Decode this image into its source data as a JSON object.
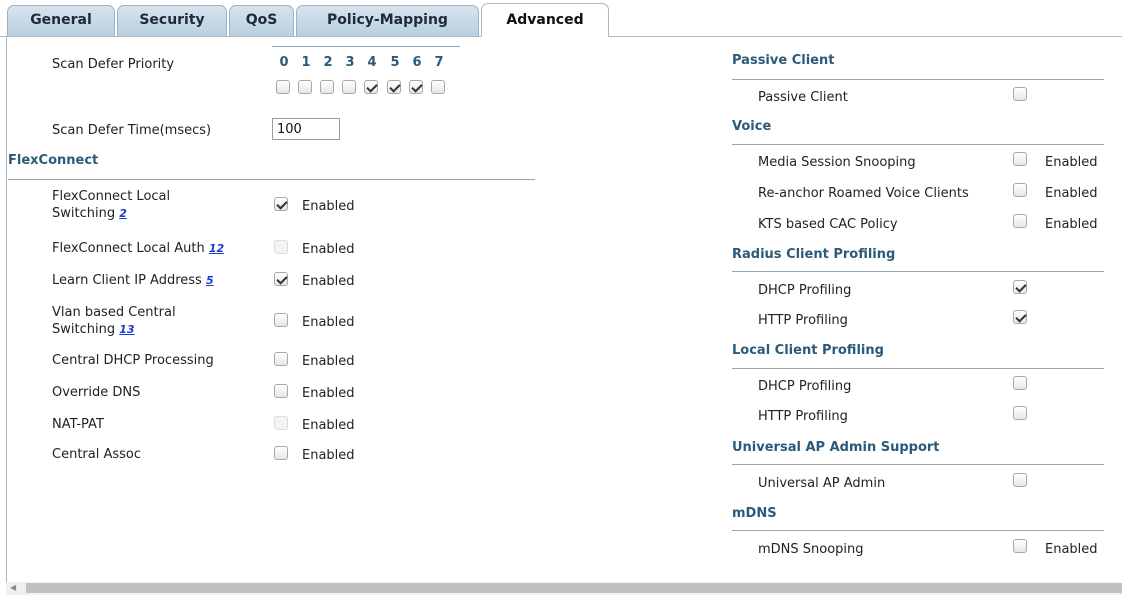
{
  "tabs": [
    {
      "label": "General"
    },
    {
      "label": "Security"
    },
    {
      "label": "QoS"
    },
    {
      "label": "Policy-Mapping"
    },
    {
      "label": "Advanced",
      "active": true
    }
  ],
  "scan_defer": {
    "priority_label": "Scan Defer Priority",
    "priorities": [
      "0",
      "1",
      "2",
      "3",
      "4",
      "5",
      "6",
      "7"
    ],
    "checked": [
      false,
      false,
      false,
      false,
      true,
      true,
      true,
      false
    ],
    "time_label": "Scan Defer Time(msecs)",
    "time_value": "100"
  },
  "flexconnect": {
    "title": "FlexConnect",
    "enabled_text": "Enabled",
    "rows": [
      {
        "line1": "FlexConnect Local",
        "line2": "Switching",
        "note": "2",
        "checked": true,
        "disabled": false
      },
      {
        "line1": "FlexConnect Local Auth",
        "note": "12",
        "checked": false,
        "disabled": true
      },
      {
        "line1": "Learn Client IP Address",
        "note": "5",
        "checked": true,
        "disabled": false
      },
      {
        "line1": "Vlan based Central",
        "line2": "Switching",
        "note": "13",
        "checked": false,
        "disabled": false
      },
      {
        "line1": "Central DHCP Processing",
        "checked": false,
        "disabled": false
      },
      {
        "line1": "Override DNS",
        "checked": false,
        "disabled": false
      },
      {
        "line1": "NAT-PAT",
        "checked": false,
        "disabled": true
      },
      {
        "line1": "Central Assoc",
        "checked": false,
        "disabled": false
      }
    ]
  },
  "right": {
    "passive": {
      "title": "Passive Client",
      "rows": [
        {
          "label": "Passive Client",
          "checked": false
        }
      ]
    },
    "voice": {
      "title": "Voice",
      "rows": [
        {
          "label": "Media Session Snooping",
          "checked": false,
          "enabled": "Enabled"
        },
        {
          "label": "Re-anchor Roamed Voice Clients",
          "checked": false,
          "enabled": "Enabled"
        },
        {
          "label": "KTS based CAC Policy",
          "checked": false,
          "enabled": "Enabled"
        }
      ]
    },
    "radius": {
      "title": "Radius Client Profiling",
      "rows": [
        {
          "label": "DHCP Profiling",
          "checked": true
        },
        {
          "label": "HTTP Profiling",
          "checked": true
        }
      ]
    },
    "local": {
      "title": "Local Client Profiling",
      "rows": [
        {
          "label": "DHCP Profiling",
          "checked": false
        },
        {
          "label": "HTTP Profiling",
          "checked": false
        }
      ]
    },
    "universal": {
      "title": "Universal AP Admin Support",
      "rows": [
        {
          "label": "Universal AP Admin",
          "checked": false
        }
      ]
    },
    "mdns": {
      "title": "mDNS",
      "rows": [
        {
          "label": "mDNS Snooping",
          "checked": false,
          "enabled": "Enabled"
        }
      ]
    }
  },
  "colors": {
    "section": "#2c5a7a",
    "tab_bg": "#c6d8e7",
    "link": "#1a3ccf"
  }
}
